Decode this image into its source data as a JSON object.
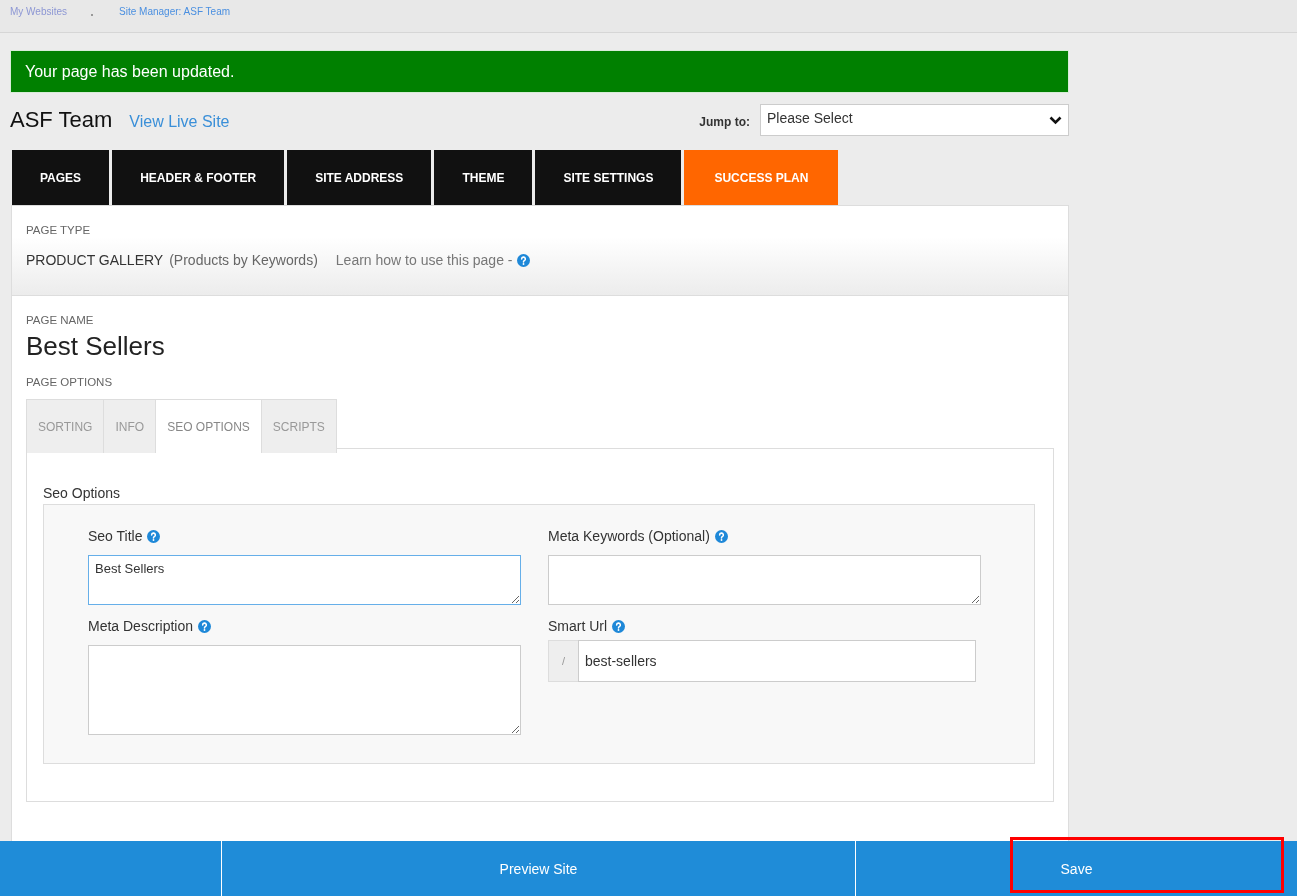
{
  "breadcrumb": [
    {
      "label": "My Websites",
      "current": false
    },
    {
      "label": "Site Manager: ASF Team",
      "current": true
    }
  ],
  "alert": {
    "kind": "success",
    "message": "Your page has been updated."
  },
  "site": {
    "name": "ASF Team",
    "live_link": "View Live Site"
  },
  "jump_to": {
    "label": "Jump to:",
    "value": "Please Select"
  },
  "main_tabs": [
    {
      "label": "PAGES",
      "kind": "nav"
    },
    {
      "label": "HEADER & FOOTER",
      "kind": "nav"
    },
    {
      "label": "SITE ADDRESS",
      "kind": "nav"
    },
    {
      "label": "THEME",
      "kind": "nav"
    },
    {
      "label": "SITE SETTINGS",
      "kind": "nav"
    },
    {
      "label": "SUCCESS PLAN",
      "kind": "promo"
    }
  ],
  "page_type": {
    "label": "PAGE TYPE",
    "type": "PRODUCT GALLERY",
    "subtype": "(Products by Keywords)",
    "help_link": "Learn how to use this page -"
  },
  "page_name": {
    "label": "PAGE NAME",
    "value": "Best Sellers"
  },
  "page_options": {
    "label": "PAGE OPTIONS",
    "tabs": [
      {
        "label": "SORTING",
        "selected": false
      },
      {
        "label": "INFO",
        "selected": false
      },
      {
        "label": "SEO OPTIONS",
        "selected": true
      },
      {
        "label": "SCRIPTS",
        "selected": false
      }
    ]
  },
  "seo": {
    "title": "Seo Options",
    "fields": [
      {
        "label": "Seo Title",
        "kind": "textarea",
        "value": "Best Sellers",
        "focused": true
      },
      {
        "label": "Meta Keywords (Optional)",
        "kind": "textarea",
        "focused": false
      },
      {
        "label": "Meta Description",
        "kind": "memo",
        "focused": false
      },
      {
        "label": "Smart Url",
        "kind": "url",
        "prefix": "/",
        "value": "best-sellers",
        "focused": false
      }
    ]
  },
  "actions": [
    {
      "label": "Preview Site",
      "highlighted": false
    },
    {
      "label": "Save",
      "highlighted": true
    }
  ]
}
